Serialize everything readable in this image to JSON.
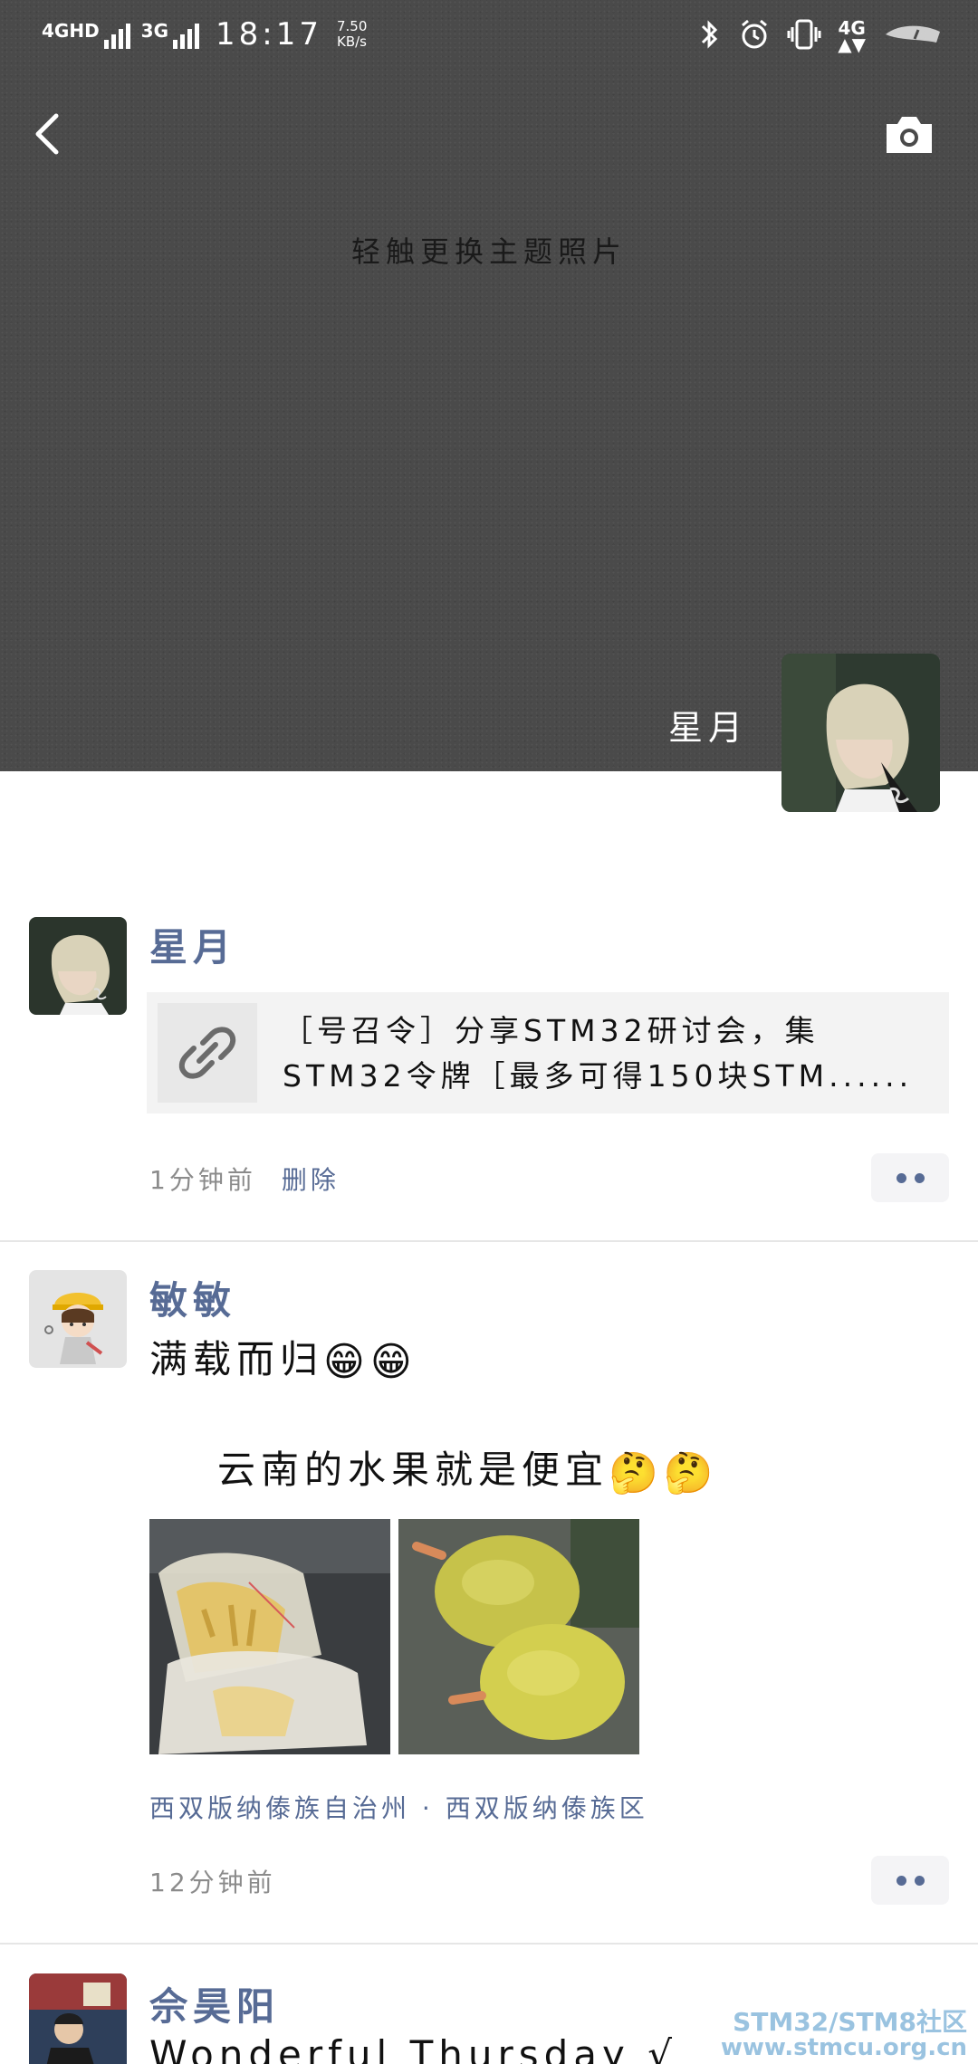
{
  "status_bar": {
    "signal1": "4GHD",
    "signal2": "3G",
    "time": "18:17",
    "speed_value": "7.50",
    "speed_unit": "KB/s",
    "network": "4G"
  },
  "cover": {
    "hint": "轻触更换主题照片",
    "profile_name": "星月"
  },
  "posts": [
    {
      "author": "星月",
      "link_title": "［号召令］分享STM32研讨会，集STM32令牌［最多可得150块STM......",
      "time": "1分钟前",
      "delete_label": "删除"
    },
    {
      "author": "敏敏",
      "line1": "满载而归",
      "line2": "云南的水果就是便宜",
      "location": "西双版纳傣族自治州 · 西双版纳傣族区",
      "time": "12分钟前"
    },
    {
      "author": "佘昊阳",
      "text": "Wonderful Thursday √"
    }
  ],
  "watermark": {
    "line1": "STM32/STM8社区",
    "line2": "www.stmcu.org.cn"
  }
}
